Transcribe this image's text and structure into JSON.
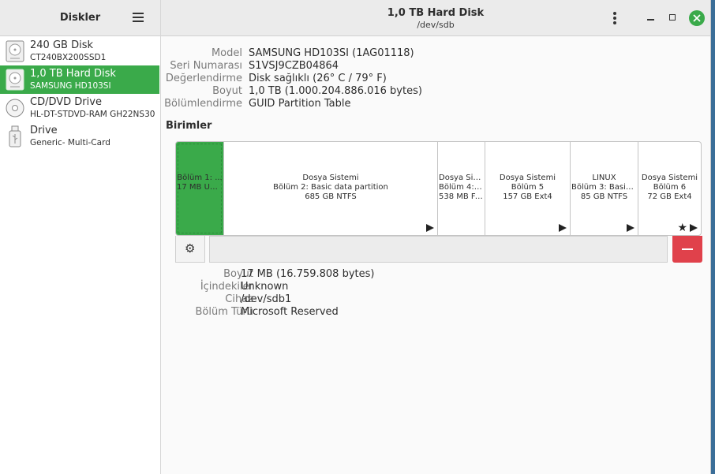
{
  "sidebar": {
    "title": "Diskler",
    "items": [
      {
        "name": "240 GB Disk",
        "sub": "CT240BX200SSD1",
        "icon": "hard-disk-icon",
        "selected": false
      },
      {
        "name": "1,0 TB Hard Disk",
        "sub": "SAMSUNG HD103SI",
        "icon": "hard-disk-icon",
        "selected": true
      },
      {
        "name": "CD/DVD Drive",
        "sub": "HL-DT-STDVD-RAM GH22NS30",
        "icon": "optical-disc-icon",
        "selected": false
      },
      {
        "name": "Drive",
        "sub": "Generic- Multi-Card",
        "icon": "usb-drive-icon",
        "selected": false
      }
    ]
  },
  "header": {
    "title": "1,0 TB Hard Disk",
    "subtitle": "/dev/sdb"
  },
  "disk_info": [
    {
      "label": "Model",
      "value": "SAMSUNG HD103SI (1AG01118)"
    },
    {
      "label": "Seri Numarası",
      "value": "S1VSJ9CZB04864"
    },
    {
      "label": "Değerlendirme",
      "value": "Disk sağlıklı (26° C / 79° F)"
    },
    {
      "label": "Boyut",
      "value": "1,0 TB (1.000.204.886.016 bytes)"
    },
    {
      "label": "Bölümlendirme",
      "value": "GUID Partition Table"
    }
  ],
  "volumes": {
    "title": "Birimler",
    "partitions": [
      {
        "lines": [
          "",
          "Bölüm 1: ...",
          "17 MB Unk..."
        ],
        "selected": true,
        "arrow": false,
        "star": false
      },
      {
        "lines": [
          "Dosya Sistemi",
          "Bölüm 2: Basic data partition",
          "685 GB NTFS"
        ],
        "selected": false,
        "arrow": true,
        "star": false
      },
      {
        "lines": [
          "Dosya Sist...",
          "Bölüm 4: E...",
          "538 MB FAT"
        ],
        "selected": false,
        "arrow": false,
        "star": false
      },
      {
        "lines": [
          "Dosya Sistemi",
          "Bölüm 5",
          "157 GB Ext4"
        ],
        "selected": false,
        "arrow": true,
        "star": false
      },
      {
        "lines": [
          "LINUX",
          "Bölüm 3: Basic ...",
          "85 GB NTFS"
        ],
        "selected": false,
        "arrow": true,
        "star": false
      },
      {
        "lines": [
          "Dosya Sistemi",
          "Bölüm 6",
          "72 GB Ext4"
        ],
        "selected": false,
        "arrow": true,
        "star": true
      }
    ]
  },
  "partition_info": [
    {
      "label": "Boyut",
      "value": "17 MB (16.759.808 bytes)"
    },
    {
      "label": "İçindekiler",
      "value": "Unknown"
    },
    {
      "label": "Cihaz",
      "value": "/dev/sdb1"
    },
    {
      "label": "Bölüm Türü",
      "value": "Microsoft Reserved"
    }
  ],
  "colors": {
    "accent": "#3aaa4a",
    "danger": "#e0414b"
  }
}
